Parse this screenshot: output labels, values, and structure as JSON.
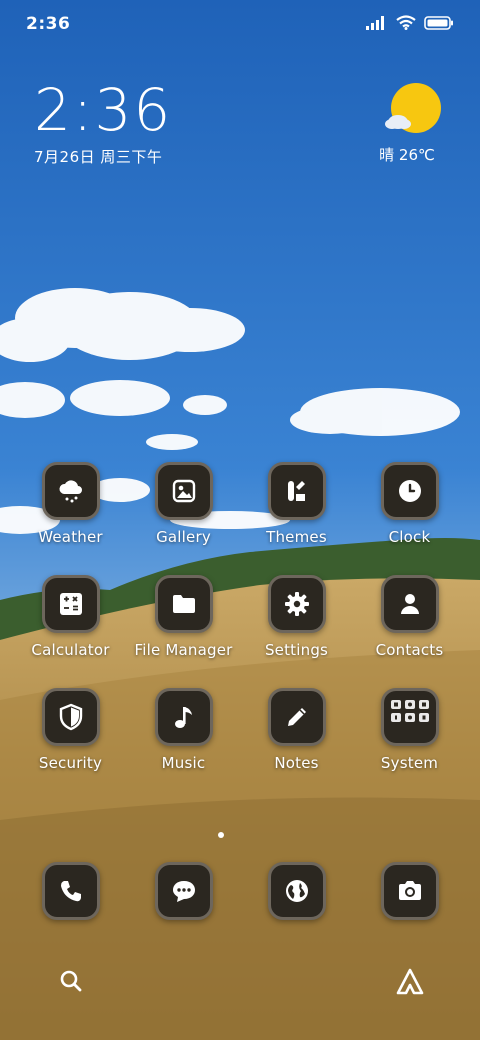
{
  "status_bar": {
    "time": "2:36",
    "icons": [
      "signal-icon",
      "wifi-icon",
      "battery-icon"
    ]
  },
  "clock_widget": {
    "time": "2:36",
    "date": "7月26日 周三下午"
  },
  "weather_widget": {
    "condition_icon": "sun-cloud-icon",
    "text": "晴 26℃"
  },
  "apps": [
    {
      "label": "Weather",
      "icon": "cloud-rain-icon"
    },
    {
      "label": "Gallery",
      "icon": "image-icon"
    },
    {
      "label": "Themes",
      "icon": "themes-icon"
    },
    {
      "label": "Clock",
      "icon": "clock-icon"
    },
    {
      "label": "Calculator",
      "icon": "calculator-icon"
    },
    {
      "label": "File Manager",
      "icon": "folder-icon"
    },
    {
      "label": "Settings",
      "icon": "gear-icon"
    },
    {
      "label": "Contacts",
      "icon": "person-icon"
    },
    {
      "label": "Security",
      "icon": "shield-icon"
    },
    {
      "label": "Music",
      "icon": "music-note-icon"
    },
    {
      "label": "Notes",
      "icon": "pencil-icon"
    },
    {
      "label": "System",
      "icon": "folder-grid-icon"
    }
  ],
  "dock": [
    {
      "icon": "phone-icon"
    },
    {
      "icon": "message-icon"
    },
    {
      "icon": "globe-icon"
    },
    {
      "icon": "camera-icon"
    }
  ],
  "bottom_bar": {
    "left_icon": "search-icon",
    "right_icon": "assistant-icon"
  },
  "page_indicator": {
    "current": 1,
    "total": 1
  },
  "colors": {
    "icon_bg": "#2b2720",
    "icon_border": "#6d665c",
    "sky": "#2f74cc",
    "wheat": "#b6944e",
    "sun": "#f7c710"
  }
}
